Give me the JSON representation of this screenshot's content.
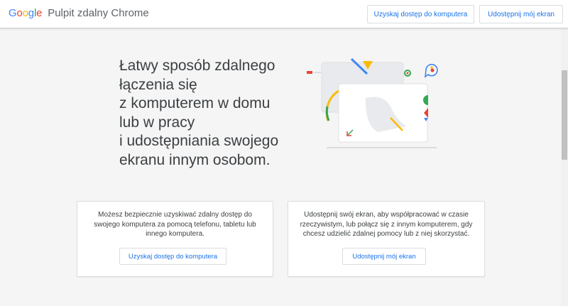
{
  "header": {
    "logo_letters": [
      {
        "char": "G",
        "color": "#4285F4"
      },
      {
        "char": "o",
        "color": "#EA4335"
      },
      {
        "char": "o",
        "color": "#FBBC05"
      },
      {
        "char": "g",
        "color": "#4285F4"
      },
      {
        "char": "l",
        "color": "#34A853"
      },
      {
        "char": "e",
        "color": "#EA4335"
      }
    ],
    "product_name": "Pulpit zdalny Chrome",
    "access_button": "Uzyskaj dostęp do komputera",
    "share_button": "Udostępnij mój ekran"
  },
  "hero": {
    "lines": [
      "Łatwy sposób zdalnego",
      "łączenia się",
      "z komputerem w domu",
      "lub w pracy",
      "i udostępniania swojego",
      "ekranu innym osobom."
    ]
  },
  "cards": {
    "access": {
      "text": "Możesz bezpiecznie uzyskiwać zdalny dostęp do swojego komputera za pomocą telefonu, tabletu lub innego komputera.",
      "button": "Uzyskaj dostęp do komputera"
    },
    "share": {
      "text": "Udostępnij swój ekran, aby współpracować w czasie rzeczywistym, lub połącz się z innym komputerem, gdy chcesz udzielić zdalnej pomocy lub z niej skorzystać.",
      "button": "Udostępnij mój ekran"
    }
  },
  "colors": {
    "accent": "#1a73e8",
    "blue": "#4285F4",
    "red": "#EA4335",
    "yellow": "#FBBC05",
    "green": "#34A853"
  },
  "icons": [
    "remote-desktop-illustration"
  ]
}
